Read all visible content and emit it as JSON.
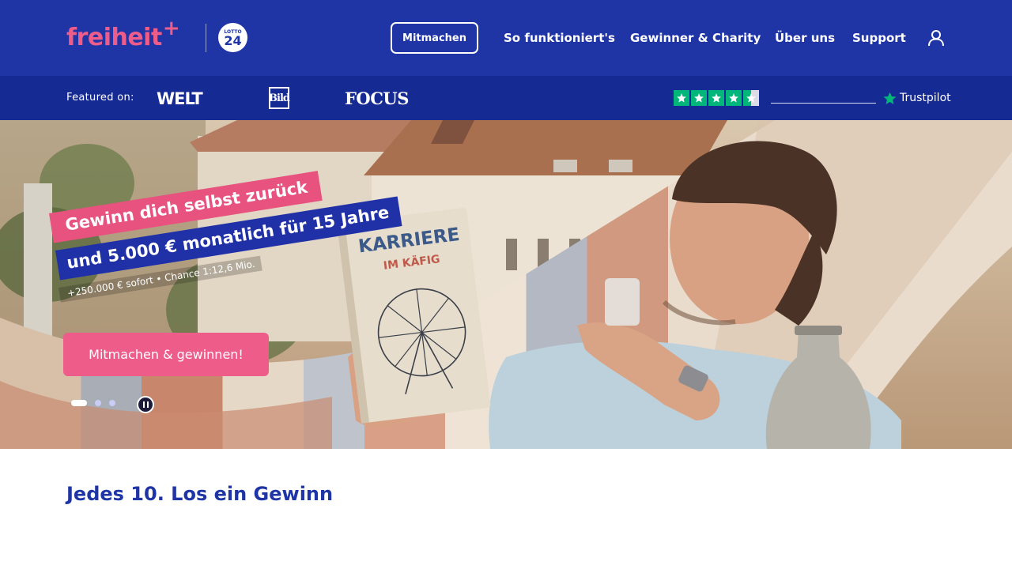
{
  "header": {
    "logo_text": "freiheit",
    "logo_plus": "+",
    "partner_badge_top": "LOTTO",
    "partner_badge_num": "24",
    "cta_label": "Mitmachen",
    "nav": [
      {
        "label": "So funktioniert's"
      },
      {
        "label": "Gewinner & Charity"
      },
      {
        "label": "Über uns"
      },
      {
        "label": "Support"
      }
    ],
    "user_icon": "user-icon"
  },
  "featured": {
    "label": "Featured on:",
    "brands": [
      "WELT",
      "Bild",
      "FOCUS"
    ],
    "trustpilot": {
      "label": "Trustpilot",
      "stars": 4.5,
      "star_color": "#00b67a"
    }
  },
  "hero": {
    "book_title_1": "KARRIERE",
    "book_title_2": "IM KÄFIG",
    "line1": "Gewinn dich selbst zurück",
    "line2": "und 5.000 € monatlich für 15 Jahre",
    "line3": "+250.000 € sofort • Chance 1:12,6 Mio.",
    "cta_label": "Mitmachen & gewinnen!",
    "carousel": {
      "slides": 3,
      "active": 1
    }
  },
  "content": {
    "title": "Jedes 10. Los ein Gewinn"
  },
  "colors": {
    "brand_blue": "#1f35a6",
    "strip_blue": "#162a93",
    "brand_pink": "#ee5c8a"
  }
}
